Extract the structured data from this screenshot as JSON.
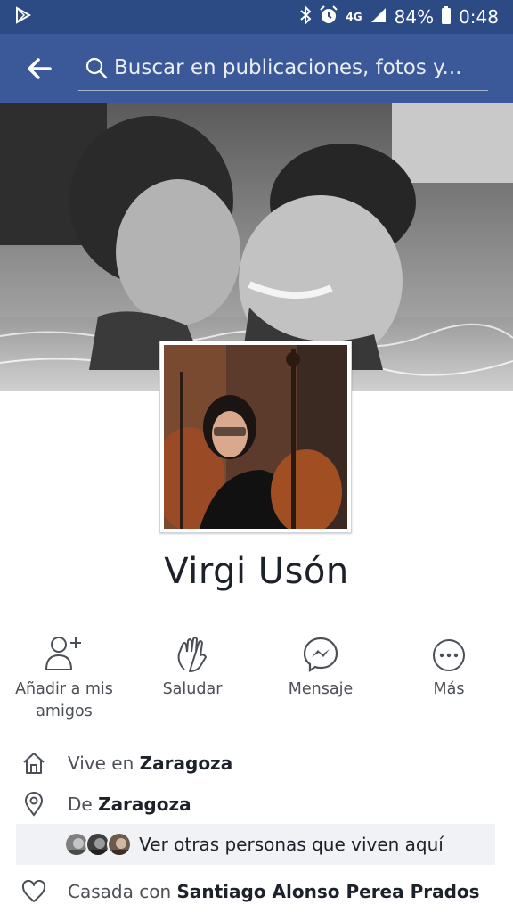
{
  "status_bar": {
    "network": "4G",
    "battery": "84%",
    "time": "0:48",
    "icons": [
      "play-store-icon",
      "bluetooth-icon",
      "alarm-icon",
      "signal-icon",
      "battery-icon"
    ]
  },
  "header": {
    "search_placeholder": "Buscar en publicaciones, fotos y...",
    "colors": {
      "bar": "#3b5998",
      "status": "#2c4b85"
    }
  },
  "profile": {
    "name": "Virgi Usón"
  },
  "actions": [
    {
      "label": "Añadir a mis amigos",
      "icon": "add-friend-icon"
    },
    {
      "label": "Saludar",
      "icon": "wave-icon"
    },
    {
      "label": "Mensaje",
      "icon": "messenger-icon"
    },
    {
      "label": "Más",
      "icon": "more-icon"
    }
  ],
  "info": {
    "lives_prefix": "Vive en ",
    "lives_city": "Zaragoza",
    "from_prefix": "De ",
    "from_city": "Zaragoza",
    "see_others": "Ver otras personas que viven aquí",
    "married_prefix": "Casada con ",
    "married_name": "Santiago Alonso Perea Prados"
  }
}
